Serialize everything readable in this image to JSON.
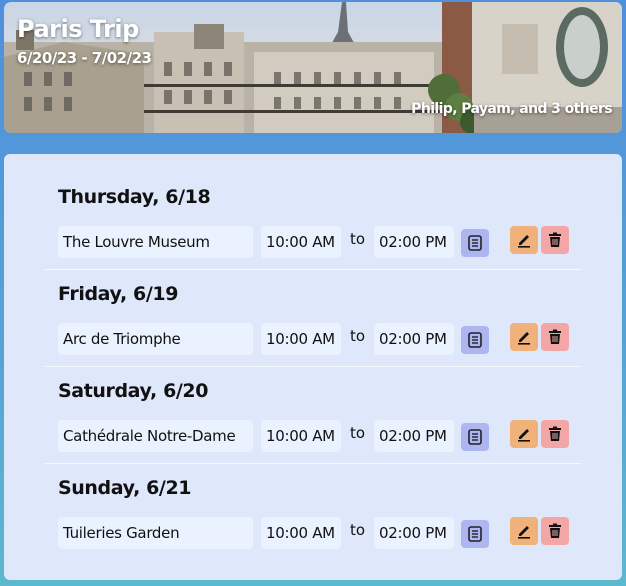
{
  "trip": {
    "title": "Paris Trip",
    "dates": "6/20/23 - 7/02/23",
    "travelers": "Philip, Payam, and 3 others"
  },
  "itinerary": [
    {
      "day": "Thursday, 6/18",
      "activity": "The Louvre Museum",
      "start": "10:00 AM",
      "to": "to",
      "end": "02:00 PM"
    },
    {
      "day": "Friday, 6/19",
      "activity": "Arc de Triomphe",
      "start": "10:00 AM",
      "to": "to",
      "end": "02:00 PM"
    },
    {
      "day": "Saturday, 6/20",
      "activity": "Cathédrale Notre-Dame",
      "start": "10:00 AM",
      "to": "to",
      "end": "02:00 PM"
    },
    {
      "day": "Sunday, 6/21",
      "activity": "Tuileries Garden",
      "start": "10:00 AM",
      "to": "to",
      "end": "02:00 PM"
    }
  ],
  "icons": {
    "notes": "notes-icon",
    "edit": "pencil-icon",
    "delete": "trash-icon"
  },
  "colors": {
    "notes_button": "#aeb6f2",
    "edit_button": "#f0b27a",
    "delete_button": "#f2a6a6",
    "panel": "#dfe8fb"
  }
}
